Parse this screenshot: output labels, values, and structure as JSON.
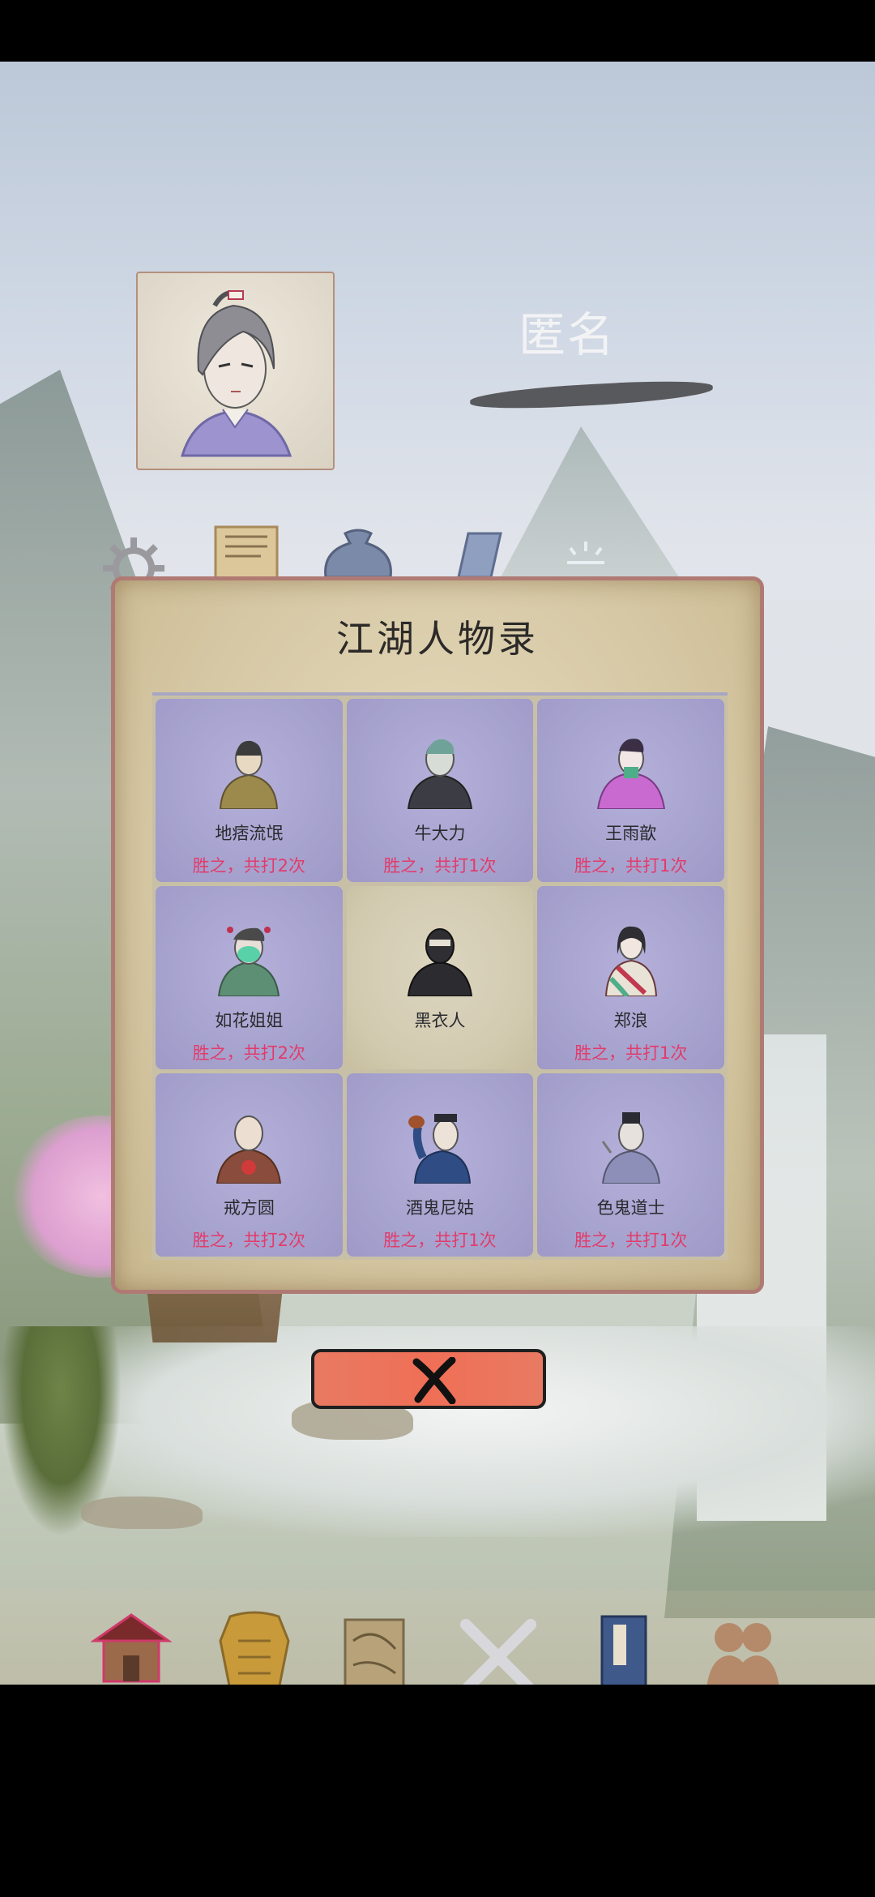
{
  "player": {
    "name": "匿名"
  },
  "modal": {
    "title": "江湖人物录",
    "characters": [
      {
        "name": "地痞流氓",
        "record": "胜之，共打2次"
      },
      {
        "name": "牛大力",
        "record": "胜之，共打1次"
      },
      {
        "name": "王雨歆",
        "record": "胜之，共打1次"
      },
      {
        "name": "如花姐姐",
        "record": "胜之，共打2次"
      },
      {
        "name": "黑衣人",
        "record": ""
      },
      {
        "name": "郑浪",
        "record": "胜之，共打1次"
      },
      {
        "name": "戒方圆",
        "record": "胜之，共打2次"
      },
      {
        "name": "酒鬼尼姑",
        "record": "胜之，共打1次"
      },
      {
        "name": "色鬼道士",
        "record": "胜之，共打1次"
      }
    ]
  },
  "nav": {
    "items": [
      {
        "label": "首页",
        "icon": "house-icon",
        "active": true
      },
      {
        "label": "装备",
        "icon": "armor-icon",
        "active": false
      },
      {
        "label": "江湖",
        "icon": "scroll-map-icon",
        "active": false
      },
      {
        "label": "闯关",
        "icon": "crossed-swords-icon",
        "active": false
      },
      {
        "label": "武功",
        "icon": "book-icon",
        "active": false
      },
      {
        "label": "伙伴",
        "icon": "companions-icon",
        "active": false
      }
    ]
  },
  "colors": {
    "beaten_cell": "#a7a3cf",
    "unbeaten_cell": "#d2caaf",
    "record_text": "#e23b6b",
    "close_button": "#ef6f56",
    "nav_label": "#e8c050"
  }
}
